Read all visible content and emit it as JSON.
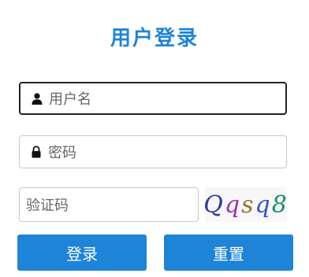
{
  "login": {
    "title": "用户登录",
    "username_placeholder": "用户名",
    "password_placeholder": "密码",
    "captcha_placeholder": "验证码",
    "captcha_chars": [
      "Q",
      "q",
      "s",
      "q",
      "8"
    ],
    "login_button": "登录",
    "reset_button": "重置"
  },
  "colors": {
    "accent": "#1d84d8",
    "captcha": [
      "#2b3aa0",
      "#9b2fb5",
      "#8c7a2d",
      "#2f55c2",
      "#1f8f6a"
    ]
  },
  "icons": {
    "username": "user-icon",
    "password": "lock-icon"
  }
}
